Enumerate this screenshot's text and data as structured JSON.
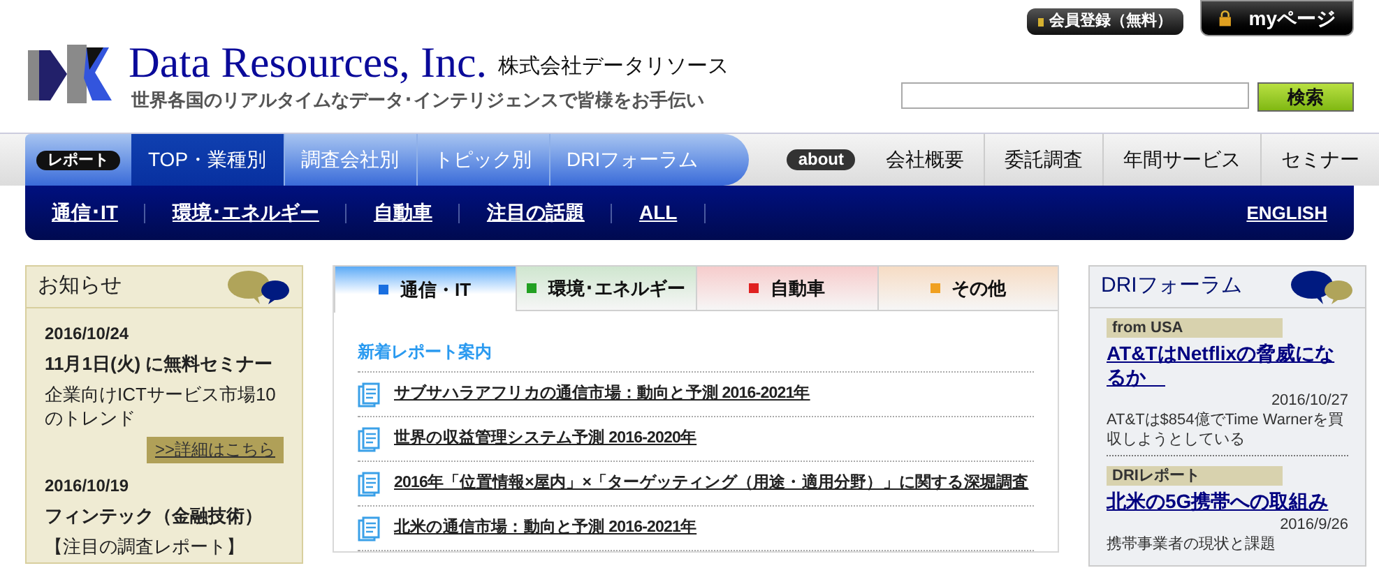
{
  "header": {
    "company": "Data Resources, Inc.",
    "company_ja": "株式会社データリソース",
    "tagline": "世界各国のリアルタイムなデータ･インテリジェンスで皆様をお手伝い",
    "register_button": "会員登録（無料）",
    "mypage_button": "myページ",
    "search": {
      "button": "検索"
    }
  },
  "main_nav": {
    "left_badge": "レポート",
    "items": [
      {
        "label": "TOP・業種別",
        "selected": true
      },
      {
        "label": "調査会社別",
        "selected": false
      },
      {
        "label": "トピック別",
        "selected": false
      },
      {
        "label": "DRIフォーラム",
        "selected": false
      }
    ],
    "right_badge": "about",
    "right_items": [
      "会社概要",
      "委託調査",
      "年間サービス",
      "セミナー"
    ]
  },
  "sub_nav": {
    "links": [
      "通信･IT",
      "環境･エネルギー",
      "自動車",
      "注目の話題",
      "ALL"
    ],
    "english": "ENGLISH"
  },
  "news": {
    "title": "お知らせ",
    "entries": [
      {
        "date": "2016/10/24",
        "title": "11月1日(火) に無料セミナー",
        "text": "企業向けICTサービス市場10のトレンド",
        "link": ">>詳細はこちら"
      },
      {
        "date": "2016/10/19",
        "title": "フィンテック（金融技術）",
        "text": "【注目の調査レポート】"
      }
    ]
  },
  "center": {
    "tabs": [
      {
        "label": "通信・IT",
        "color": "#1a6fe0",
        "selected": true
      },
      {
        "label": "環境･エネルギー",
        "color": "#22a022",
        "selected": false
      },
      {
        "label": "自動車",
        "color": "#e02020",
        "selected": false
      },
      {
        "label": "その他",
        "color": "#f0a020",
        "selected": false
      }
    ],
    "section_title": "新着レポート案内",
    "reports": [
      "サブサハラアフリカの通信市場：動向と予測 2016-2021年",
      "世界の収益管理システム予測 2016-2020年",
      "2016年「位置情報×屋内」×「ターゲッティング（用途・適用分野）」に関する深堀調査",
      "北米の通信市場：動向と予測 2016-2021年"
    ]
  },
  "forum": {
    "title": "DRIフォーラム",
    "entries": [
      {
        "tag": "from USA",
        "title": "AT&TはNetflixの脅威になるか　",
        "date": "2016/10/27",
        "text": "AT&Tは$854億でTime Warnerを買収しようとしている"
      },
      {
        "tag": "DRIレポート",
        "title": "北米の5G携帯への取組み",
        "date": "2016/9/26",
        "text": "携帯事業者の現状と課題"
      }
    ]
  }
}
